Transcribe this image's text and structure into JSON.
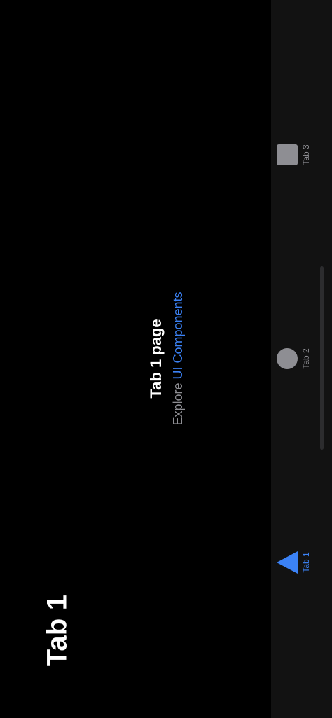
{
  "header": {
    "large_title": "Tab 1"
  },
  "main": {
    "page_title": "Tab 1 page",
    "explore_prefix": "Explore",
    "explore_link": "UI Components"
  },
  "tabbar": {
    "items": [
      {
        "label": "Tab 1",
        "icon": "triangle-icon",
        "active": true
      },
      {
        "label": "Tab 2",
        "icon": "circle-icon",
        "active": false
      },
      {
        "label": "Tab 3",
        "icon": "square-icon",
        "active": false
      }
    ]
  },
  "colors": {
    "accent": "#3b82f6",
    "inactive": "#8e8e93",
    "background": "#000000",
    "tabbar_background": "#121212"
  }
}
